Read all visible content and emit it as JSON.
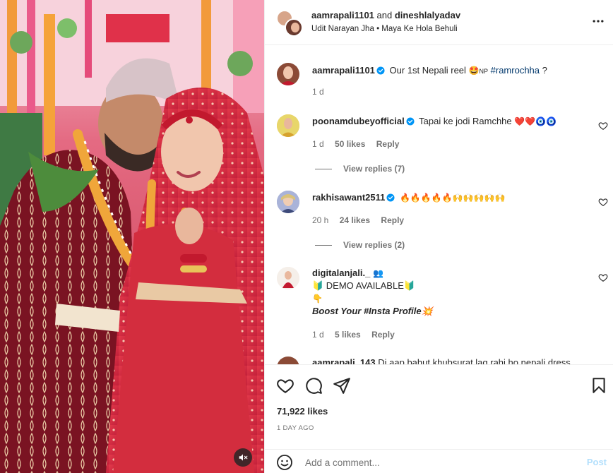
{
  "header": {
    "user1": "aamrapali1101",
    "and_text": "and",
    "user2": "dineshlalyadav",
    "audio_artist": "Udit Narayan Jha",
    "audio_separator": "•",
    "audio_title": "Maya Ke Hola Behuli",
    "more_icon": "more-horizontal-icon"
  },
  "caption": {
    "username": "aamrapali1101",
    "text_before": "Our 1st Nepali reel",
    "emoji": "🤩",
    "flag": "NP",
    "hashtag": "#ramrochha",
    "trailing": "?",
    "time": "1 d"
  },
  "comments": [
    {
      "username": "poonamdubeyofficial",
      "text": "Tapai ke jodi Ramchhe",
      "emojis": "❤️❤️🧿🧿",
      "time": "1 d",
      "likes": "50 likes",
      "reply": "Reply",
      "view_replies": "View replies (7)"
    },
    {
      "username": "rakhisawant2511",
      "text": "",
      "emojis": "🔥🔥🔥🔥🔥🙌🙌🙌🙌🙌",
      "time": "20 h",
      "likes": "24 likes",
      "reply": "Reply",
      "view_replies": "View replies (2)"
    },
    {
      "username": "digitalanjali._",
      "user_emoji": "👥",
      "line1": "🔰 DEMO AVAILABLE🔰",
      "line2": "👇",
      "line3": "Boost Your #Insta Profile💥",
      "time": "1 d",
      "likes": "5 likes",
      "reply": "Reply"
    },
    {
      "username": "aamrapali_143",
      "text": "Di aap bahut khubsurat lag rahi ho nepali dress"
    }
  ],
  "actions": {
    "likes": "71,922 likes",
    "date": "1 DAY AGO"
  },
  "add_comment": {
    "placeholder": "Add a comment...",
    "post_label": "Post"
  },
  "colors": {
    "verified": "#0095f6",
    "link_blue": "#00376b",
    "post_disabled": "#b2dffc",
    "secondary_text": "#737373"
  }
}
